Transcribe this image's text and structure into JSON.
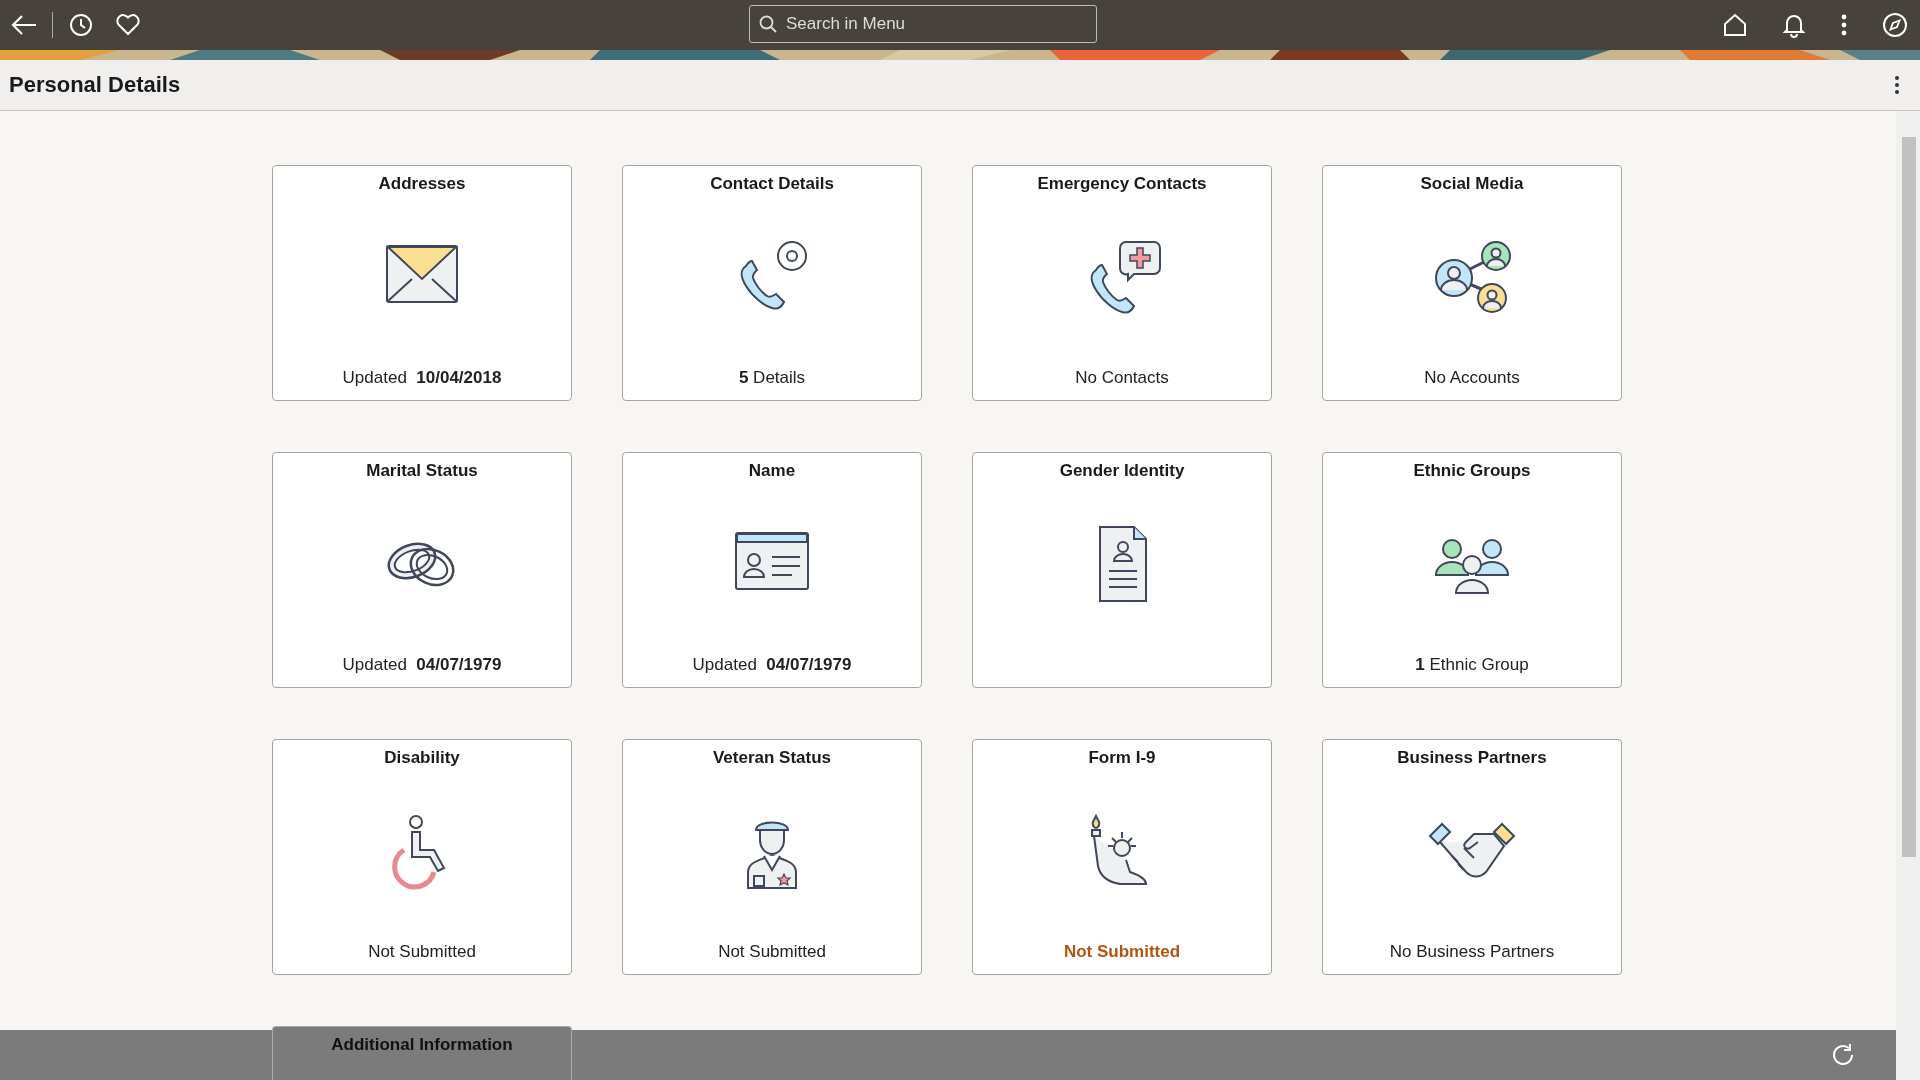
{
  "top_bar": {
    "search": {
      "placeholder": "Search in Menu"
    }
  },
  "page": {
    "title": "Personal Details"
  },
  "tiles": [
    {
      "title": "Addresses",
      "status": "Updated  **10/04/2018**",
      "warning": false
    },
    {
      "title": "Contact Details",
      "status": "**5** Details",
      "warning": false
    },
    {
      "title": "Emergency Contacts",
      "status": "No Contacts",
      "warning": false
    },
    {
      "title": "Social Media",
      "status": "No Accounts",
      "warning": false
    },
    {
      "title": "Marital Status",
      "status": "Updated  **04/07/1979**",
      "warning": false
    },
    {
      "title": "Name",
      "status": "Updated  **04/07/1979**",
      "warning": false
    },
    {
      "title": "Gender Identity"
    },
    {
      "title": "Ethnic Groups",
      "status": "**1** Ethnic Group",
      "warning": false
    },
    {
      "title": "Disability",
      "status": "Not Submitted",
      "warning": false
    },
    {
      "title": "Veteran Status",
      "status": "Not Submitted",
      "warning": false
    },
    {
      "title": "Form I-9",
      "status": "Not Submitted",
      "warning": true
    },
    {
      "title": "Business Partners",
      "status": "No Business Partners",
      "warning": false
    },
    {
      "title": "Additional Information"
    }
  ]
}
